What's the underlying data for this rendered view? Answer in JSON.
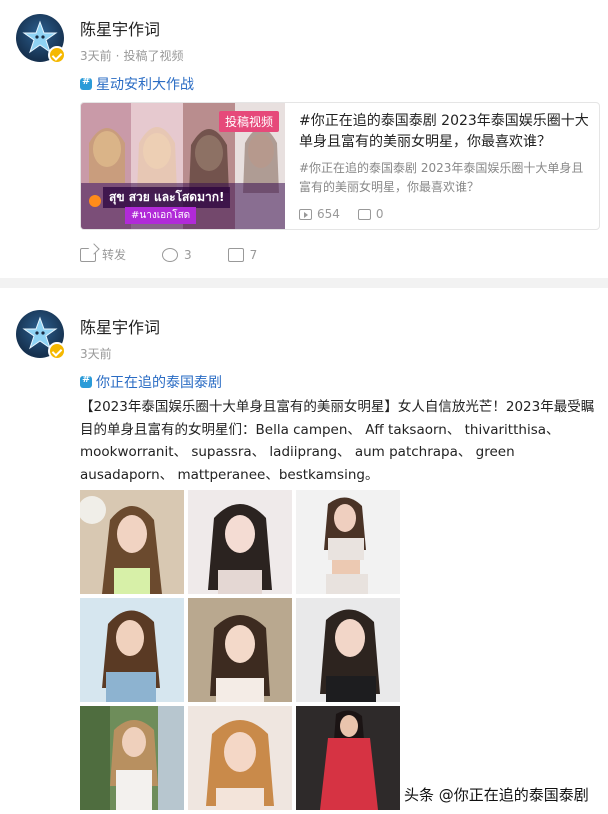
{
  "post1": {
    "author": "陈星宇作词",
    "time": "3天前",
    "action": "投稿了视频",
    "topic": "星动安利大作战",
    "card": {
      "badge": "投稿视频",
      "thumb_caption": "สุข สวย และโสดมาก!",
      "thumb_tag": "#นางเอกโสด",
      "title": "#你正在追的泰国泰剧 2023年泰国娱乐圈十大单身且富有的美丽女明星，你最喜欢谁？",
      "subtitle": "#你正在追的泰国泰剧 2023年泰国娱乐圈十大单身且富有的美丽女明星，你最喜欢谁？",
      "plays": "654",
      "comments": "0"
    },
    "actions": {
      "share": "转发",
      "comments": "3",
      "likes": "7"
    }
  },
  "post2": {
    "author": "陈星宇作词",
    "time": "3天前",
    "topic": "你正在追的泰国泰剧",
    "text": "【2023年泰国娱乐圈十大单身且富有的美丽女明星】女人自信放光芒！2023年最受瞩目的单身且富有的女明星们：Bella campen、 Aff taksaorn、 thivaritthisa、 mookworranit、 supassra、 ladiiprang、 aum patchrapa、 green ausadaporn、 mattperanee、bestkamsing。"
  },
  "watermark": "头条 @你正在追的泰国泰剧",
  "colors": {
    "link": "#2a6cc4",
    "badge": "#e6497a",
    "verified": "#f5b800"
  }
}
